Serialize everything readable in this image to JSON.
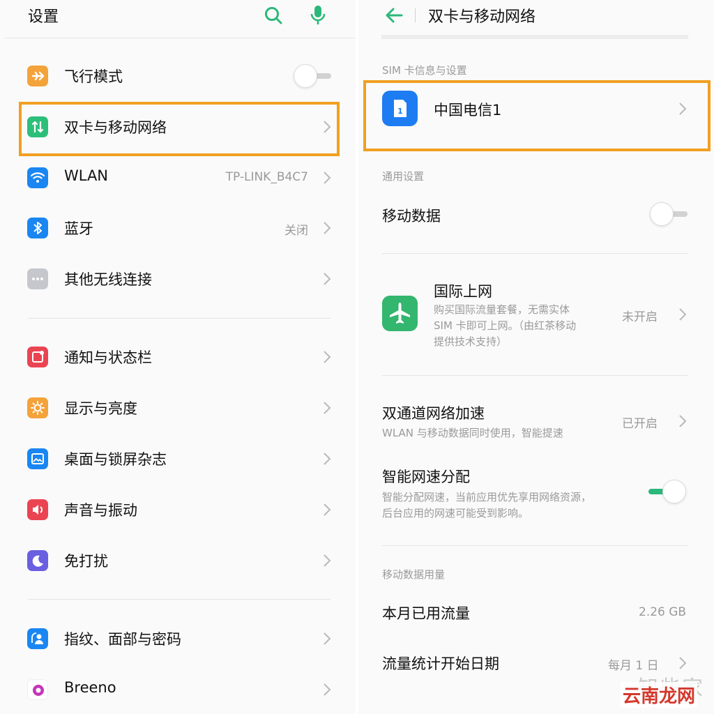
{
  "left": {
    "title": "设置",
    "items": [
      {
        "label": "飞行模式",
        "value": "",
        "icon": "airplane-icon",
        "color": "#f4a23a",
        "toggle": "off"
      },
      {
        "label": "双卡与移动网络",
        "value": "",
        "icon": "dual-sim-icon",
        "color": "#2cbf7a"
      },
      {
        "label": "WLAN",
        "value": "TP-LINK_B4C7",
        "icon": "wifi-icon",
        "color": "#1a86f2"
      },
      {
        "label": "蓝牙",
        "value": "关闭",
        "icon": "bluetooth-icon",
        "color": "#1a86f2"
      },
      {
        "label": "其他无线连接",
        "value": "",
        "icon": "more-dots-icon",
        "color": "#c5c7cc"
      },
      {
        "label": "通知与状态栏",
        "value": "",
        "icon": "notification-icon",
        "color": "#ea4452"
      },
      {
        "label": "显示与亮度",
        "value": "",
        "icon": "brightness-icon",
        "color": "#f4a23a"
      },
      {
        "label": "桌面与锁屏杂志",
        "value": "",
        "icon": "wallpaper-icon",
        "color": "#1a86f2"
      },
      {
        "label": "声音与振动",
        "value": "",
        "icon": "sound-icon",
        "color": "#ea4452"
      },
      {
        "label": "免打扰",
        "value": "",
        "icon": "moon-icon",
        "color": "#6a5fe0"
      },
      {
        "label": "指纹、面部与密码",
        "value": "",
        "icon": "fingerprint-icon",
        "color": "#1a86f2"
      },
      {
        "label": "Breeno",
        "value": "",
        "icon": "breeno-icon",
        "color": "#c436b8"
      }
    ]
  },
  "right": {
    "title": "双卡与移动网络",
    "sections": {
      "sim": "SIM 卡信息与设置",
      "general": "通用设置",
      "usage": "移动数据用量"
    },
    "sim_name": "中国电信1",
    "sim_badge": "1",
    "mobile_data": "移动数据",
    "intl": {
      "title": "国际上网",
      "desc_1": "购买国际流量套餐，无需实体",
      "desc_2": "SIM 卡即可上网。（由红茶移动",
      "desc_3": "提供技术支持）",
      "value": "未开启"
    },
    "dual_channel": {
      "title": "双通道网络加速",
      "desc": "WLAN 与移动数据同时使用，智能提速",
      "value": "已开启"
    },
    "smart_speed": {
      "title": "智能网速分配",
      "desc_1": "智能分配网速，当前应用优先享用网络资源，",
      "desc_2": "后台应用的网速可能受到影响。"
    },
    "month_usage": {
      "title": "本月已用流量",
      "value": "2.26 GB"
    },
    "start_date": {
      "title": "流量统计开始日期",
      "value": "每月 1 日"
    }
  },
  "watermark": {
    "text_1": "知些家",
    "text_2": "云南龙网"
  },
  "colors": {
    "accent": "#2cb87a",
    "highlight": "#f0a022"
  }
}
